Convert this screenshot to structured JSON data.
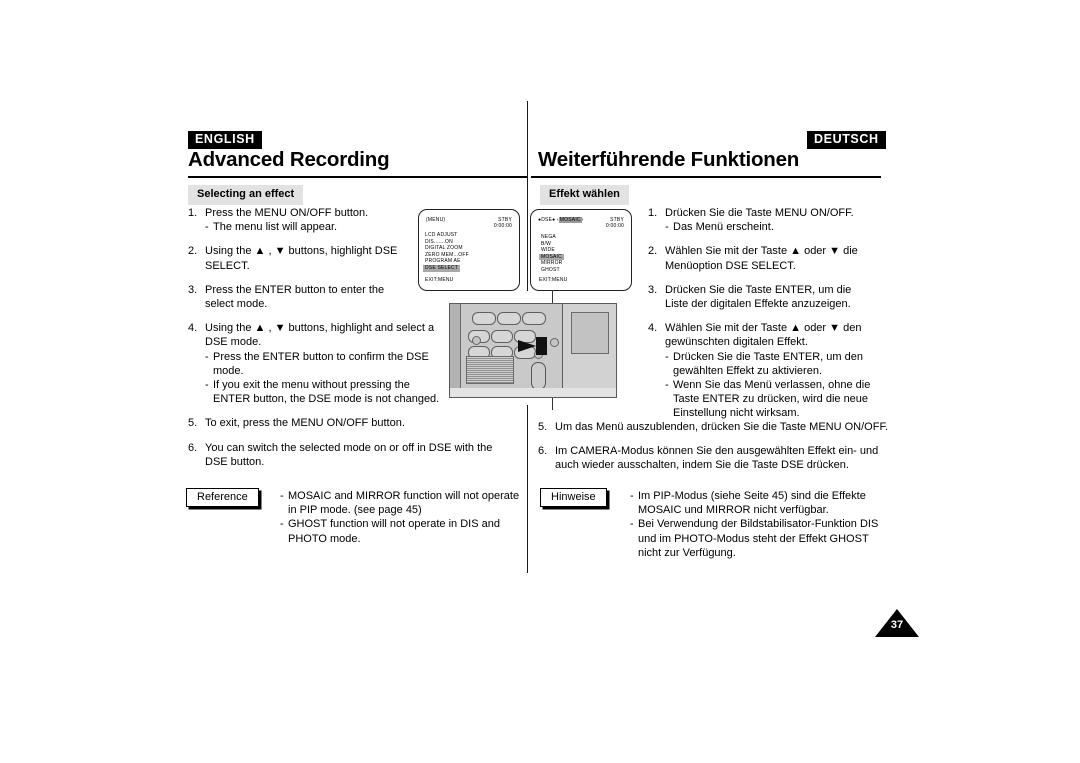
{
  "page": {
    "number": "37"
  },
  "left": {
    "lang_badge": "ENGLISH",
    "chapter_title": "Advanced Recording",
    "section_heading": "Selecting an effect",
    "steps": [
      {
        "num": "1.",
        "lines": [
          "Press the MENU ON/OFF button."
        ],
        "subs": [
          "The menu list will appear."
        ]
      },
      {
        "num": "2.",
        "lines": [
          "Using the ▲ , ▼ buttons, highlight DSE",
          "SELECT."
        ],
        "subs": []
      },
      {
        "num": "3.",
        "lines": [
          "Press the ENTER button to enter the",
          "select mode."
        ],
        "subs": []
      },
      {
        "num": "4.",
        "lines": [
          "Using the ▲ , ▼ buttons, highlight and select a",
          "DSE mode."
        ],
        "subs": [
          "Press the ENTER button to confirm the DSE\nmode.",
          "If you exit the menu without pressing the\nENTER button, the DSE mode is not changed."
        ]
      },
      {
        "num": "5.",
        "lines": [
          "To exit, press the MENU ON/OFF button."
        ],
        "subs": []
      },
      {
        "num": "6.",
        "lines": [
          "You can switch the selected mode on or off in DSE with the",
          "DSE button."
        ],
        "subs": []
      }
    ],
    "reference_label": "Reference",
    "reference_items": [
      "MOSAIC and MIRROR function will not operate\nin PIP mode. (see page 45)",
      "GHOST function will not operate in DIS  and\nPHOTO mode."
    ]
  },
  "right": {
    "lang_badge": "DEUTSCH",
    "chapter_title": "Weiterführende Funktionen",
    "section_heading": "Effekt wählen",
    "steps": [
      {
        "num": "1.",
        "lines": [
          "Drücken Sie die Taste MENU ON/OFF."
        ],
        "subs": [
          "Das Menü erscheint."
        ]
      },
      {
        "num": "2.",
        "lines": [
          "Wählen Sie mit der Taste ▲ oder ▼ die",
          "Menüoption DSE SELECT."
        ],
        "subs": []
      },
      {
        "num": "3.",
        "lines": [
          "Drücken Sie die Taste ENTER, um die",
          "Liste der digitalen Effekte anzuzeigen."
        ],
        "subs": []
      },
      {
        "num": "4.",
        "lines": [
          "Wählen Sie mit der Taste ▲ oder ▼ den",
          "gewünschten digitalen Effekt."
        ],
        "subs": [
          "Drücken Sie die Taste ENTER, um den\ngewählten Effekt zu aktivieren.",
          "Wenn Sie das Menü verlassen, ohne die\nTaste ENTER zu drücken, wird die neue\nEinstellung nicht wirksam."
        ]
      }
    ],
    "steps_wide": [
      {
        "num": "5.",
        "lines": [
          "Um das Menü auszublenden, drücken Sie die Taste MENU ON/OFF."
        ],
        "subs": []
      },
      {
        "num": "6.",
        "lines": [
          "Im CAMERA-Modus können Sie den ausgewählten Effekt ein- und",
          "auch wieder ausschalten, indem Sie die Taste DSE drücken."
        ],
        "subs": []
      }
    ],
    "reference_label": "Hinweise",
    "reference_items": [
      "Im PIP-Modus (siehe Seite 45) sind die Effekte\nMOSAIC und MIRROR nicht verfügbar.",
      "Bei Verwendung der Bildstabilisator-Funktion DIS\nund im PHOTO-Modus steht der Effekt GHOST\nnicht zur Verfügung."
    ]
  },
  "lcd_screen_1": {
    "top_left": "(MENU)",
    "status": "STBY",
    "timecode": "0:00:00",
    "items": [
      {
        "label": "LCD  ADJUST",
        "highlighted": false
      },
      {
        "label": "DIS.......ON",
        "highlighted": false
      },
      {
        "label": "DIGITAL  ZOOM",
        "highlighted": false
      },
      {
        "label": "ZERO  MEM...OFF",
        "highlighted": false
      },
      {
        "label": "PROGRAM  AE",
        "highlighted": false
      },
      {
        "label": "DSE  SELECT",
        "highlighted": true
      }
    ],
    "exit": "EXIT:MENU"
  },
  "lcd_screen_2": {
    "top_left_prefix": "●DSE●",
    "top_left_selected": "MOSAIC",
    "top_left_arrow_open": "‹",
    "top_left_arrow_close": "›",
    "status": "STBY",
    "timecode": "0:00:00",
    "items": [
      {
        "label": "NEGA",
        "highlighted": false
      },
      {
        "label": "B/W",
        "highlighted": false
      },
      {
        "label": "WIDE",
        "highlighted": false
      },
      {
        "label": "MOSAIC",
        "highlighted": true
      },
      {
        "label": "MIRROR",
        "highlighted": false
      },
      {
        "label": "GHOST",
        "highlighted": false
      }
    ],
    "exit": "EXIT:MENU"
  },
  "illustration": {
    "name": "camcorder-body-dse-button"
  }
}
